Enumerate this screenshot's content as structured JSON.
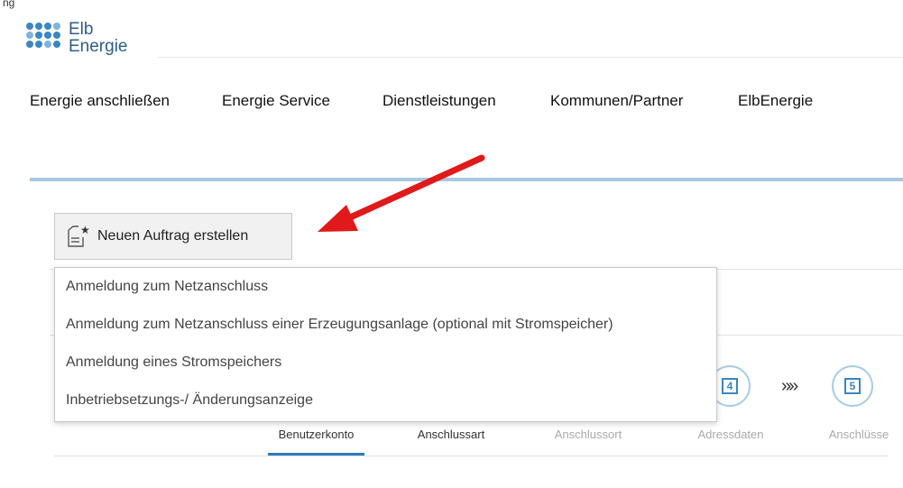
{
  "header_tag": "ng",
  "logo": {
    "line1": "Elb",
    "line2": "Energie",
    "color": "#2f5e86"
  },
  "nav": [
    "Energie anschließen",
    "Energie Service",
    "Dienstleistungen",
    "Kommunen/Partner",
    "ElbEnergie"
  ],
  "new_order_button": {
    "label": "Neuen Auftrag erstellen",
    "icon": "document-star-icon"
  },
  "dropdown_options": [
    "Anmeldung zum Netzanschluss",
    "Anmeldung zum Netzanschluss einer Erzeugungsanlage (optional mit Stromspeicher)",
    "Anmeldung eines Stromspeichers",
    "Inbetriebsetzungs-/ Änderungsanzeige"
  ],
  "steps": [
    {
      "number": "",
      "label": "Benutzerkonto",
      "active": true
    },
    {
      "number": "",
      "label": "Anschlussart",
      "active": false
    },
    {
      "number": "",
      "label": "Anschlussort",
      "active": false
    },
    {
      "number": "4",
      "label": "Adressdaten",
      "active": false
    },
    {
      "number": "5",
      "label": "Anschlüsse",
      "active": false
    }
  ],
  "step_separator": "»»",
  "colors": {
    "accent": "#2a7dbd",
    "arrow": "#e01a1a",
    "divider": "#a9c8e2"
  }
}
